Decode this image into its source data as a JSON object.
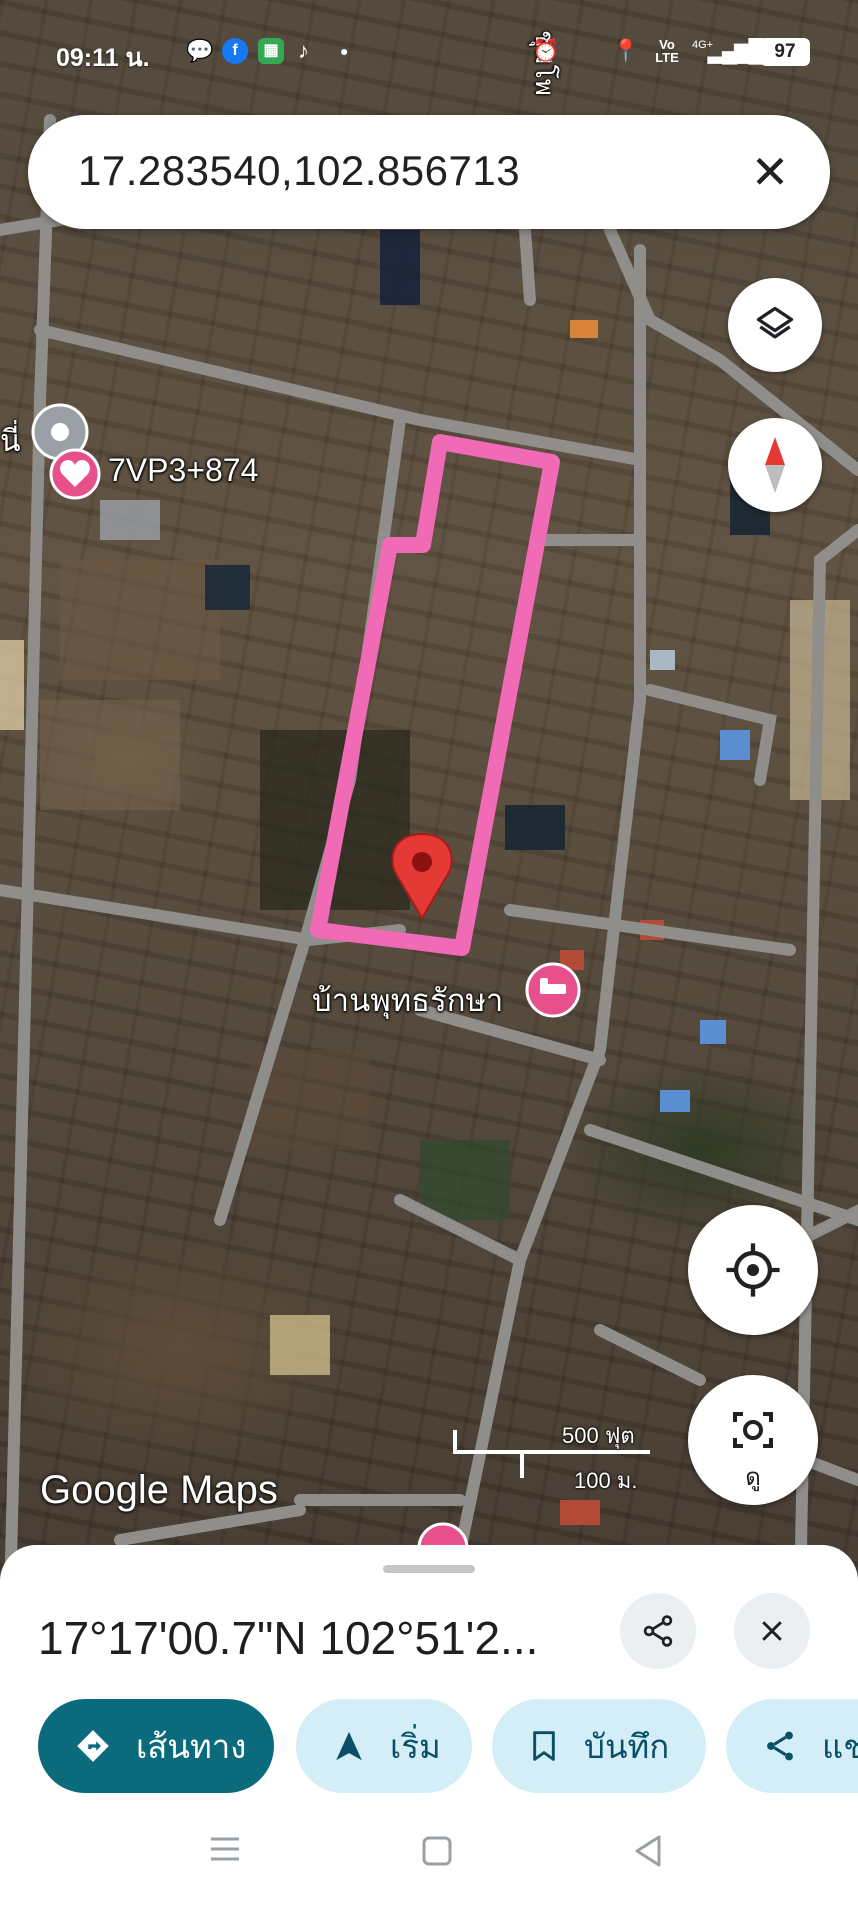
{
  "status_bar": {
    "time": "09:11 น.",
    "battery": "97",
    "network": "4G+",
    "volte": "Vo LTE"
  },
  "search": {
    "value": "17.283540,102.856713"
  },
  "map": {
    "plus_code_label": "7VP3+874",
    "place_label": "บ้านพุทธรักษา",
    "edge_label": "นี่",
    "road_label": "ชุมโพ",
    "scale": {
      "imperial": "500 ฟุต",
      "metric": "100 ม."
    },
    "logo": "Google Maps",
    "outline_color": "#f06ab5",
    "pin_color": "#e53935"
  },
  "controls": {
    "view_label": "ดู"
  },
  "sheet": {
    "title": "17°17'00.7\"N 102°51'2...",
    "chips": [
      {
        "label": "เส้นทาง",
        "icon": "directions-icon"
      },
      {
        "label": "เริ่ม",
        "icon": "navigation-arrow-icon"
      },
      {
        "label": "บันทึก",
        "icon": "bookmark-icon"
      },
      {
        "label": "แชร์",
        "icon": "share-icon"
      }
    ]
  }
}
